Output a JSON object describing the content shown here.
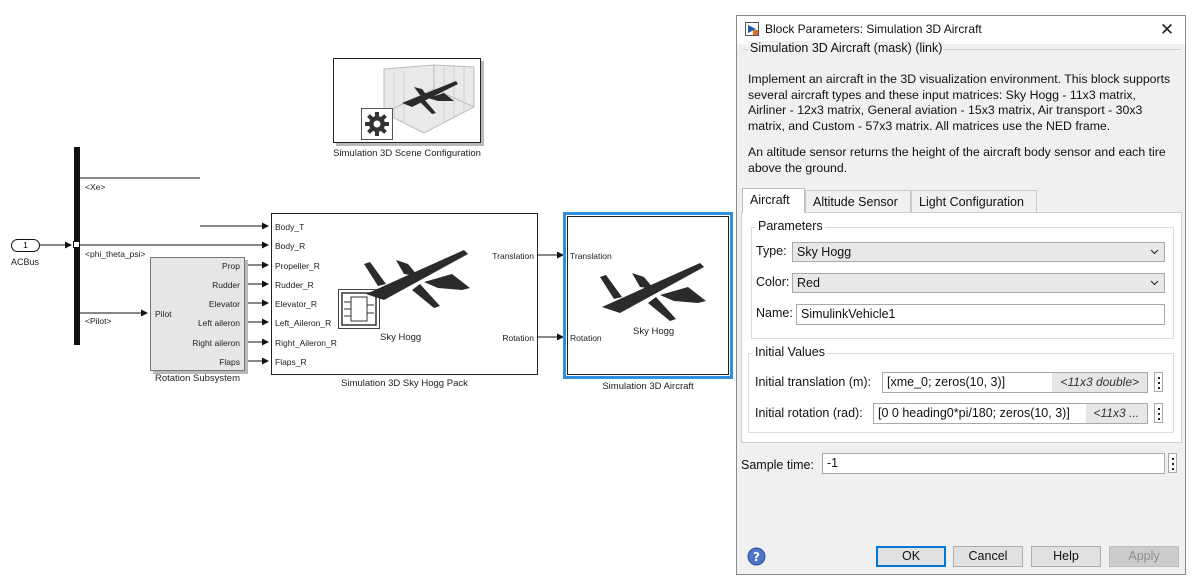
{
  "model": {
    "inport": {
      "number": "1",
      "name": "ACBus"
    },
    "bus_selector": {
      "outputs": [
        "<Xe>",
        "<phi_theta_psi>",
        "<Pilot>"
      ]
    },
    "rotation_subsystem": {
      "name": "Rotation Subsystem",
      "input": "Pilot",
      "outputs": [
        "Prop",
        "Rudder",
        "Elevator",
        "Left aileron",
        "Right aileron",
        "Flaps"
      ]
    },
    "sky_hogg_pack": {
      "name": "Simulation 3D Sky Hogg Pack",
      "inputs": [
        "Body_T",
        "Body_R",
        "Propeller_R",
        "Rudder_R",
        "Elevator_R",
        "Left_Aileron_R",
        "Right_Aileron_R",
        "Flaps_R"
      ],
      "outputs": [
        "Translation",
        "Rotation"
      ],
      "label": "Sky Hogg"
    },
    "scene_config": {
      "name": "Simulation 3D Scene Configuration"
    },
    "aircraft_block": {
      "name": "Simulation 3D Aircraft",
      "inputs": [
        "Translation",
        "Rotation"
      ],
      "label": "Sky Hogg"
    }
  },
  "dialog": {
    "title": "Block Parameters: Simulation 3D Aircraft",
    "mask_title": "Simulation 3D Aircraft (mask) (link)",
    "description": "Implement an aircraft in the 3D visualization environment. This block supports several aircraft types and these input matrices: Sky Hogg - 11x3 matrix, Airliner - 12x3 matrix, General aviation - 15x3 matrix, Air transport - 30x3 matrix, and Custom - 57x3 matrix. All matrices use the NED frame.",
    "description2": "An altitude sensor returns the height of the aircraft body sensor and each tire above the ground.",
    "tabs": [
      "Aircraft",
      "Altitude Sensor",
      "Light Configuration"
    ],
    "parameters": {
      "legend": "Parameters",
      "type_label": "Type:",
      "type_value": "Sky Hogg",
      "color_label": "Color:",
      "color_value": "Red",
      "name_label": "Name:",
      "name_value": "SimulinkVehicle1"
    },
    "initial_values": {
      "legend": "Initial Values",
      "translation_label": "Initial translation (m):",
      "translation_value": "[xme_0; zeros(10, 3)]",
      "translation_hint": "<11x3 double>",
      "rotation_label": "Initial rotation (rad):",
      "rotation_value": "[0 0 heading0*pi/180; zeros(10, 3)]",
      "rotation_hint": "<11x3 ..."
    },
    "sample_time_label": "Sample time:",
    "sample_time_value": "-1",
    "buttons": {
      "ok": "OK",
      "cancel": "Cancel",
      "help": "Help",
      "apply": "Apply"
    }
  },
  "colors": {
    "accent": "#0078d7",
    "selection": "#2f8fe0",
    "block_fill": "#e4e4e4"
  },
  "icons": [
    "gear-icon",
    "airplane-icon",
    "help-icon",
    "close-icon",
    "chevron-down-icon",
    "axes-3d-icon",
    "bus-icon"
  ]
}
